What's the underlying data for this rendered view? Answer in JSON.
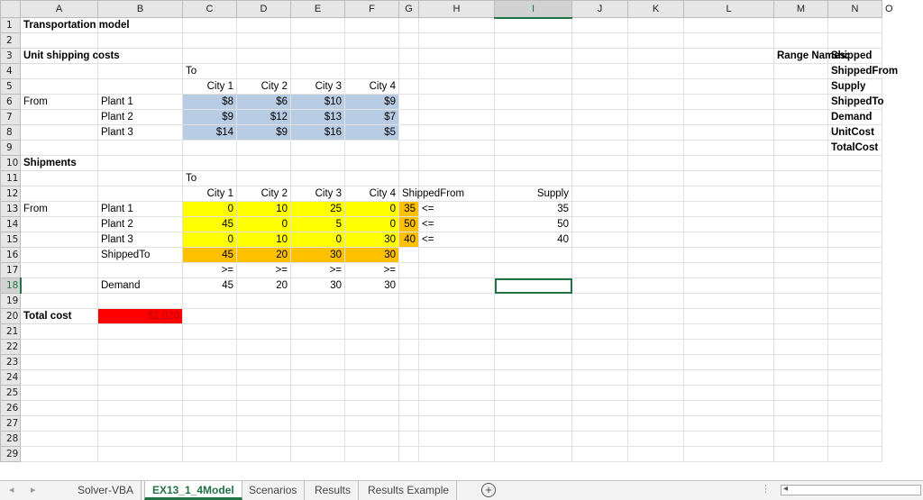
{
  "columns": [
    "A",
    "B",
    "C",
    "D",
    "E",
    "F",
    "G",
    "H",
    "I",
    "J",
    "K",
    "L",
    "M",
    "N",
    "O"
  ],
  "rows": [
    "1",
    "2",
    "3",
    "4",
    "5",
    "6",
    "7",
    "8",
    "9",
    "10",
    "11",
    "12",
    "13",
    "14",
    "15",
    "16",
    "17",
    "18",
    "19",
    "20",
    "21",
    "22",
    "23",
    "24",
    "25",
    "26",
    "27",
    "28",
    "29"
  ],
  "labels": {
    "title": "Transportation model",
    "unit_costs": "Unit shipping costs",
    "to": "To",
    "from": "From",
    "shipments": "Shipments",
    "shipped_from": "ShippedFrom",
    "shipped_to": "ShippedTo",
    "supply": "Supply",
    "demand": "Demand",
    "total_cost": "Total cost",
    "lte": "<=",
    "gte": ">="
  },
  "cities": [
    "City 1",
    "City 2",
    "City 3",
    "City 4"
  ],
  "plants": [
    "Plant 1",
    "Plant 2",
    "Plant 3"
  ],
  "unit_costs": [
    [
      "$8",
      "$6",
      "$10",
      "$9"
    ],
    [
      "$9",
      "$12",
      "$13",
      "$7"
    ],
    [
      "$14",
      "$9",
      "$16",
      "$5"
    ]
  ],
  "shipments": [
    [
      "0",
      "10",
      "25",
      "0"
    ],
    [
      "45",
      "0",
      "5",
      "0"
    ],
    [
      "0",
      "10",
      "0",
      "30"
    ]
  ],
  "shipped_from_values": [
    "35",
    "50",
    "40"
  ],
  "supply_values": [
    "35",
    "50",
    "40"
  ],
  "shipped_to_values": [
    "45",
    "20",
    "30",
    "30"
  ],
  "demand_values": [
    "45",
    "20",
    "30",
    "30"
  ],
  "total_cost_value": "$1,020",
  "range_names_label": "Range Names:",
  "range_names": [
    "Shipped",
    "ShippedFrom",
    "Supply",
    "ShippedTo",
    "Demand",
    "UnitCost",
    "TotalCost"
  ],
  "tabs": [
    "Solver-VBA",
    "EX13_1_4Model",
    "Scenarios",
    "Results",
    "Results Example"
  ],
  "colors": {
    "cost_fill": "#b8cce4",
    "shipment_fill": "#ffff00",
    "orange_fill": "#ffc000",
    "total_fill": "#ff0000",
    "accent": "#217346"
  }
}
